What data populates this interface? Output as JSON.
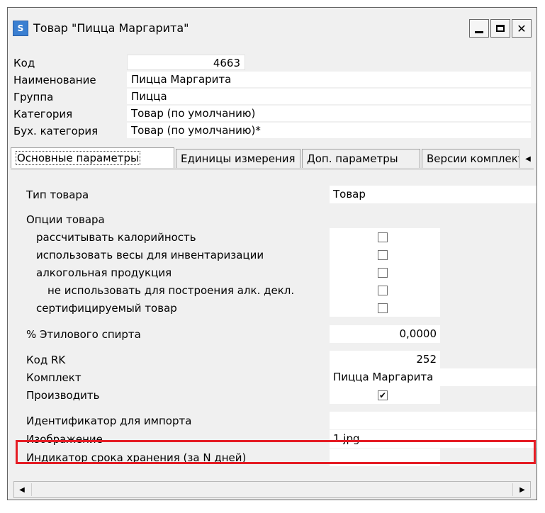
{
  "window": {
    "title": "Товар \"Пицца Маргарита\"",
    "icon_text": "S",
    "buttons": {
      "minimize": "minimize-icon",
      "maximize": "maximize-icon",
      "close": "close-icon",
      "close_glyph": "✕"
    }
  },
  "header": {
    "code_label": "Код",
    "code_value": "4663",
    "name_label": "Наименование",
    "name_value": "Пицца Маргарита",
    "group_label": "Группа",
    "group_value": "Пицца",
    "category_label": "Категория",
    "category_value": "Товар (по умолчанию)",
    "acct_category_label": "Бух. категория",
    "acct_category_value": "Товар (по умолчанию)*"
  },
  "tabs": [
    "Основные параметры",
    "Единицы измерения",
    "Доп. параметры",
    "Версии комплект"
  ],
  "props": {
    "type_label": "Тип товара",
    "type_value": "Товар",
    "options_label": "Опции товара",
    "calories_label": "рассчитывать калорийность",
    "calories_checked": false,
    "weights_label": "использовать весы для инвентаризации",
    "weights_checked": false,
    "alcohol_label": "алкогольная продукция",
    "alcohol_checked": false,
    "no_decl_label": "не использовать для  построения алк. декл.",
    "no_decl_checked": false,
    "certified_label": "сертифицируемый товар",
    "certified_checked": false,
    "ethyl_label": "% Этилового спирта",
    "ethyl_value": "0,0000",
    "rk_label": "Код RK",
    "rk_value": "252",
    "kit_label": "Комплект",
    "kit_value": "Пицца Маргарита",
    "produce_label": "Производить",
    "produce_checked": true,
    "check_glyph": "✔",
    "import_id_label": "Идентификатор для импорта",
    "import_id_value": "",
    "image_label": "Изображение",
    "image_value": "1.jpg",
    "shelf_label": "Индикатор срока хранения (за N дней)",
    "shelf_value": ""
  },
  "scroll": {
    "left_glyph": "◀",
    "right_glyph": "▶",
    "tab_scroll_glyph": "◀"
  },
  "colors": {
    "highlight": "#e51c24",
    "window_bg": "#f0f0f0"
  }
}
